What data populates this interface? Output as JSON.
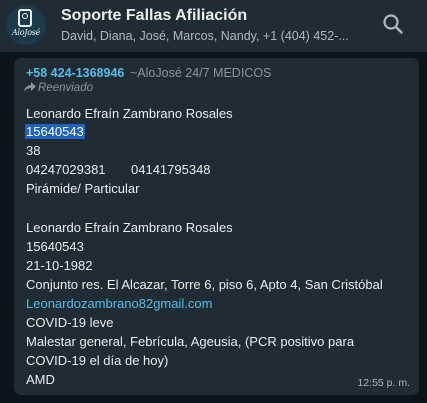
{
  "header": {
    "avatar_text": "AloJosé",
    "title": "Soporte Fallas Afiliación",
    "subtitle": "David, Diana, José, Marcos, Nandy, +1 (404) 452-..."
  },
  "message": {
    "sender_phone": "+58 424-1368946",
    "sender_name": "~AloJosé 24/7 MEDICOS",
    "forwarded_label": "Reenviado",
    "lines": {
      "l1": "Leonardo Efraín Zambrano Rosales",
      "l2": "15640543",
      "l3": "38",
      "l4a": "04247029381",
      "l4b": "04141795348",
      "l5": "Pirámide/ Particular",
      "l6": "Leonardo Efraín Zambrano Rosales",
      "l7": "15640543",
      "l8": "21-10-1982",
      "l9": "Conjunto res. El Alcazar, Torre 6, piso 6, Apto 4, San Cristóbal",
      "l10": "Leonardozambrano82gmail.com",
      "l11": "COVID-19 leve",
      "l12": "Malestar general, Febrícula, Ageusia, (PCR positivo para",
      "l13": "COVID-19 el día de hoy)",
      "l14": "AMD"
    },
    "time": "12:55 p. m."
  },
  "icons": {
    "search": "search-icon",
    "forward": "forward-icon"
  },
  "colors": {
    "background": "#0b141a",
    "bubble": "#202c33",
    "header": "#202c33",
    "link": "#53bdeb",
    "highlight": "#1e63c4"
  }
}
